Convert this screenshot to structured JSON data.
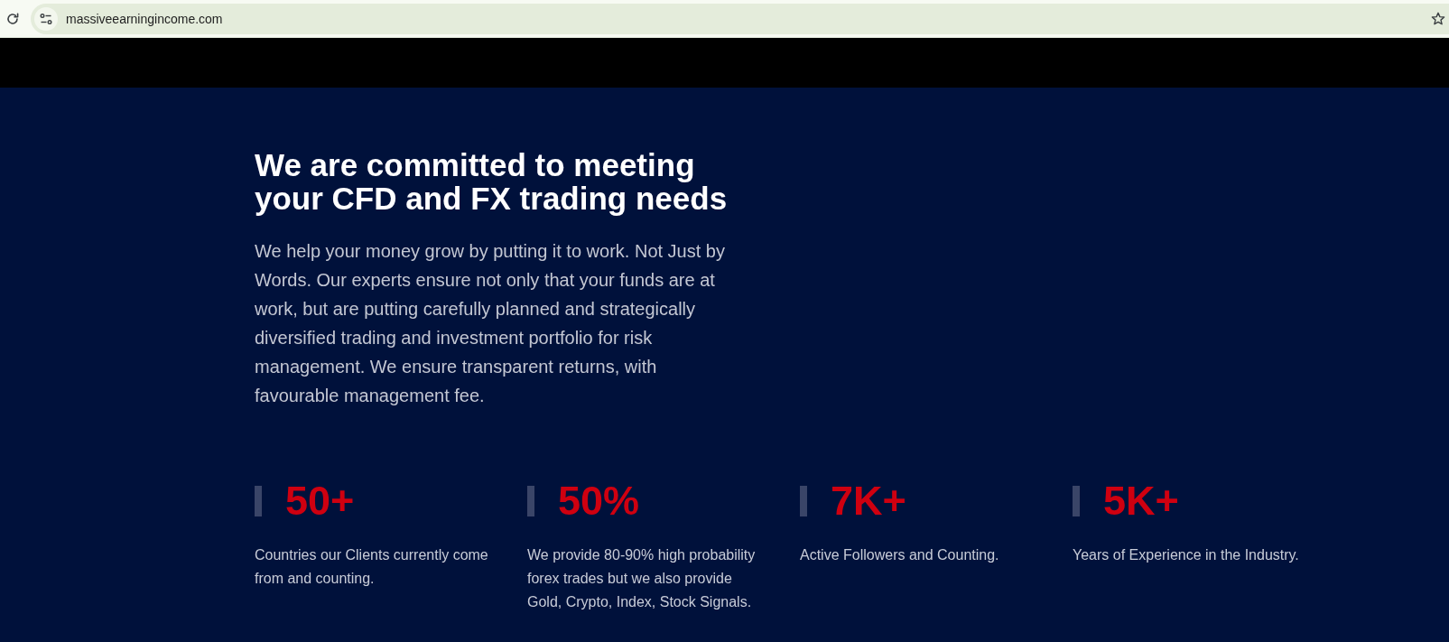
{
  "browser": {
    "url": "massiveearningincome.com"
  },
  "hero": {
    "heading": "We are committed to meeting your CFD and FX trading needs",
    "body": "We help your money grow by putting it to work. Not Just by Words. Our experts ensure not only that your funds are at work, but are putting carefully planned and strategically diversified trading and investment portfolio for risk management. We ensure transparent returns, with favourable management fee."
  },
  "stats": [
    {
      "value": "50+",
      "description": "Countries our Clients currently come from and counting."
    },
    {
      "value": "50%",
      "description": "We provide 80-90% high probability forex trades but we also provide Gold, Crypto, Index, Stock Signals."
    },
    {
      "value": "7K+",
      "description": "Active Followers and Counting."
    },
    {
      "value": "5K+",
      "description": "Years of Experience in the Industry."
    }
  ]
}
